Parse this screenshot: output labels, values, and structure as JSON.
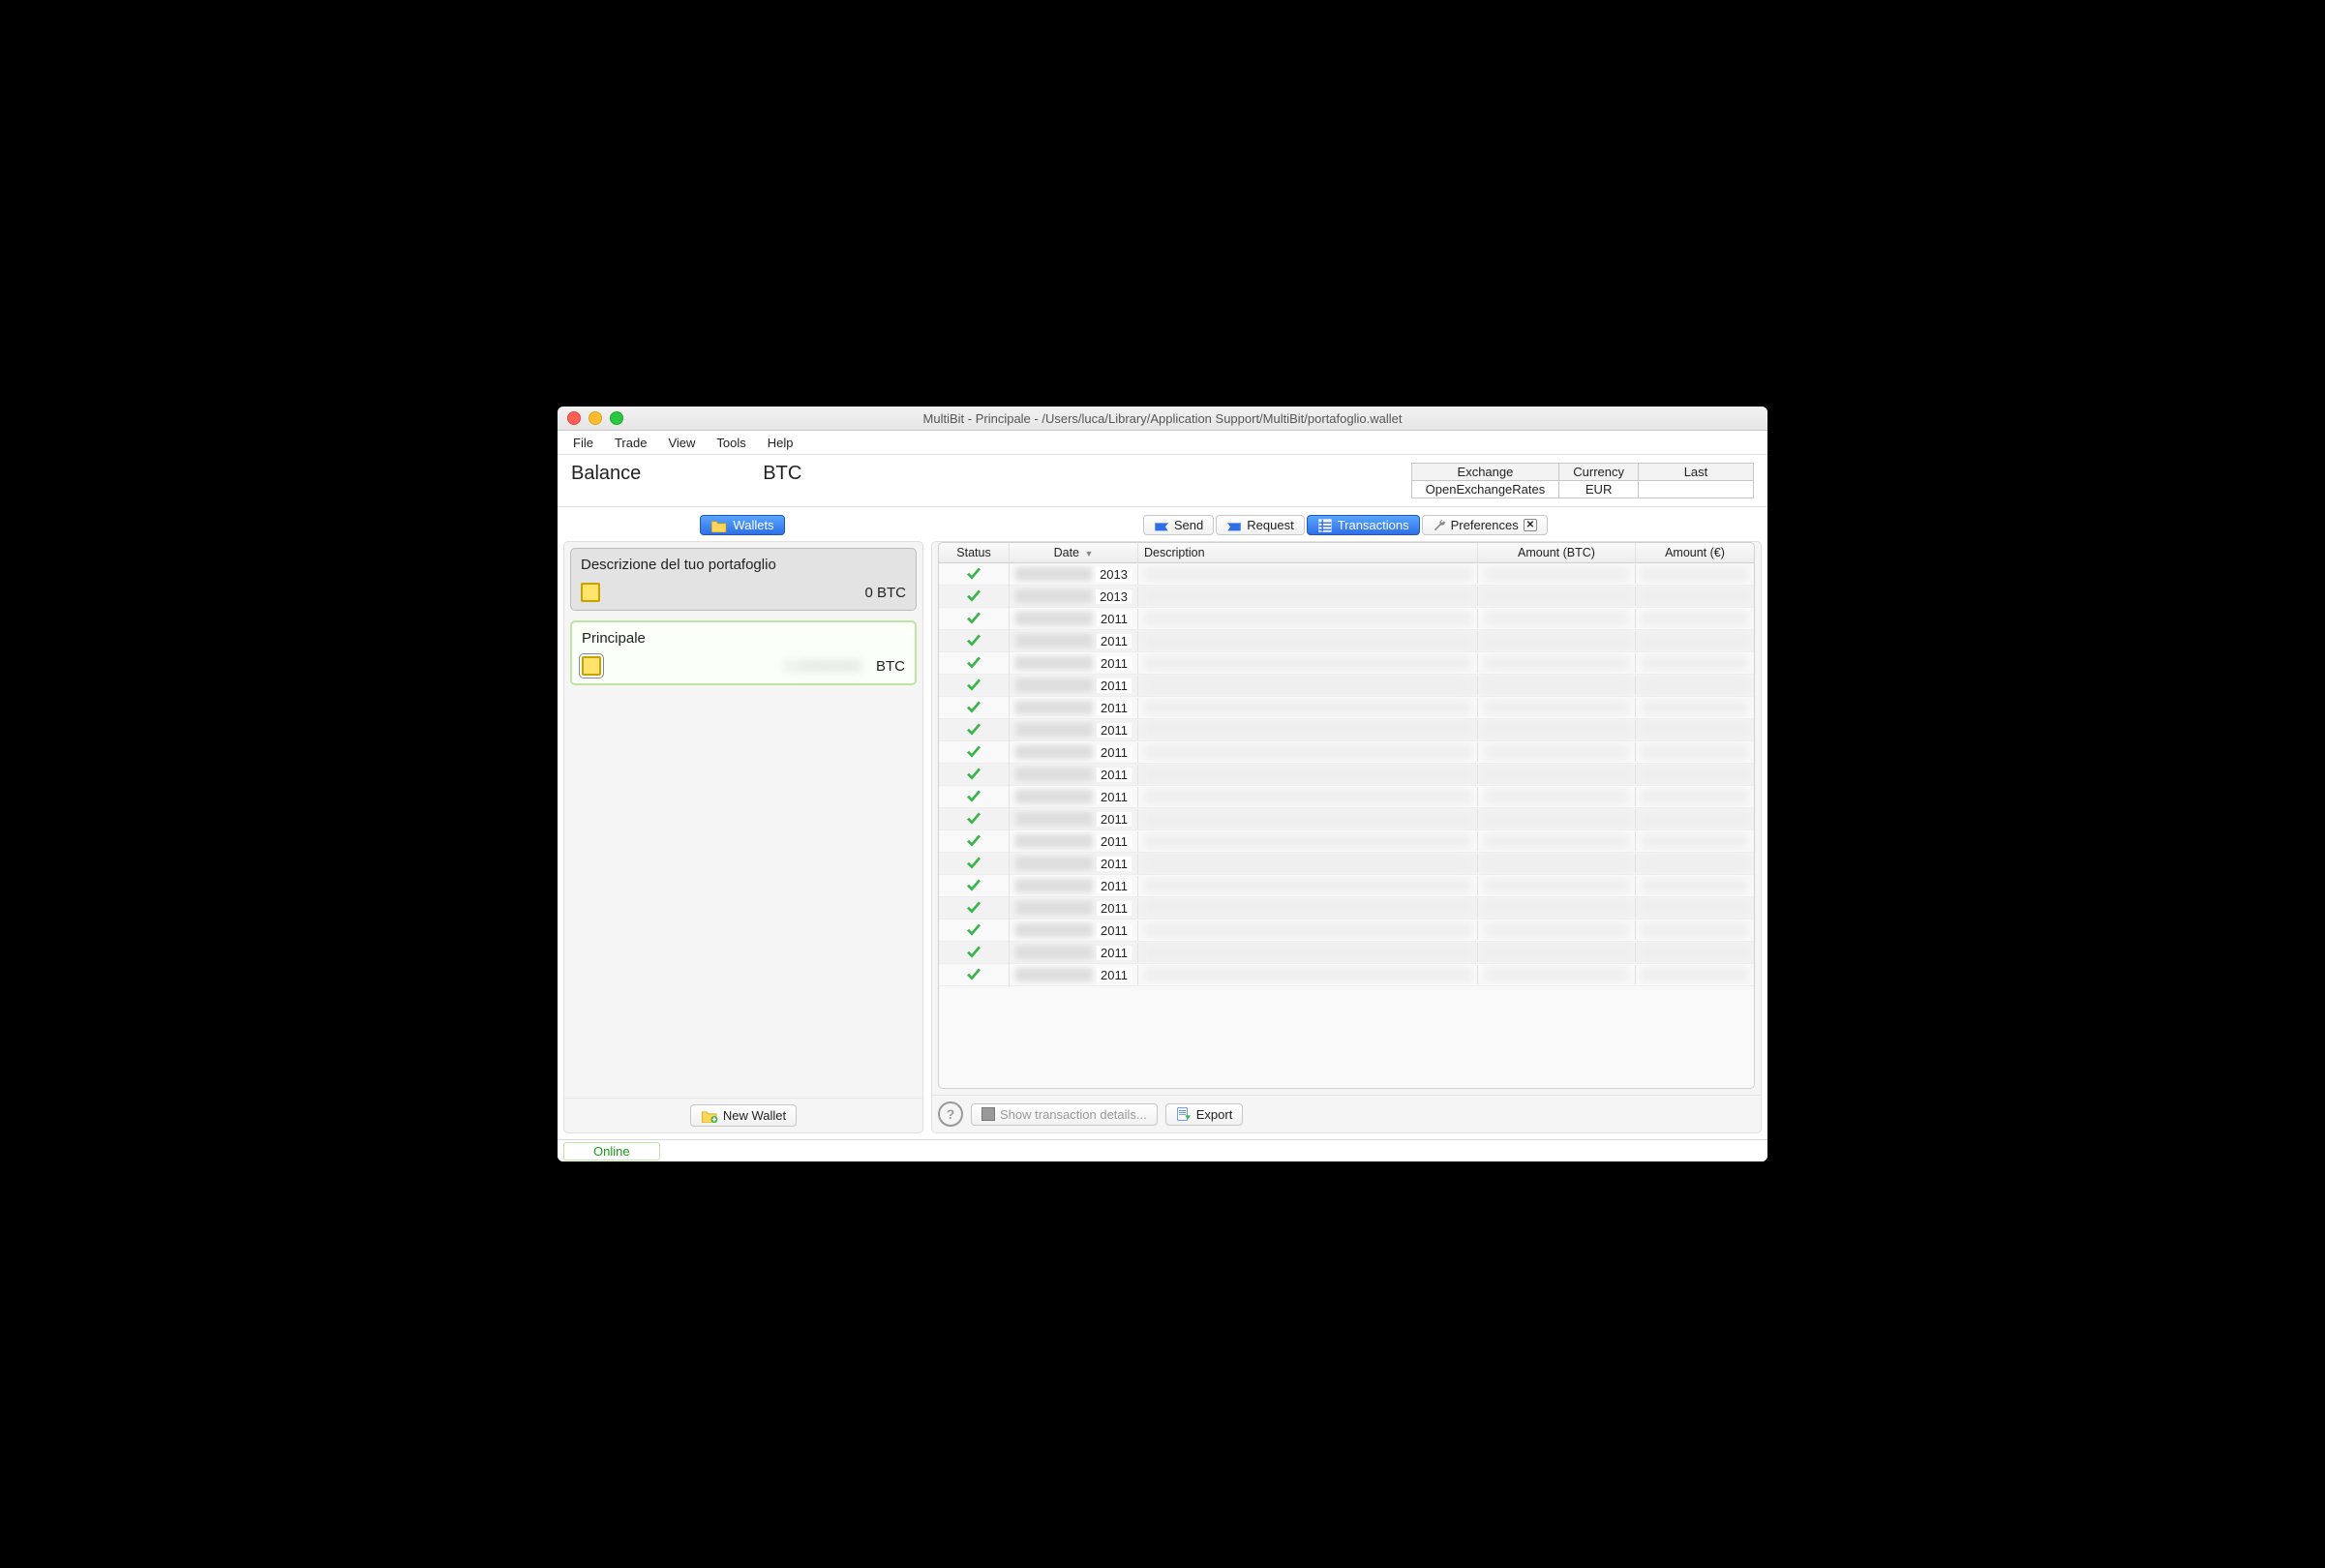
{
  "window": {
    "title": "MultiBit - Principale - /Users/luca/Library/Application Support/MultiBit/portafoglio.wallet"
  },
  "menubar": [
    "File",
    "Trade",
    "View",
    "Tools",
    "Help"
  ],
  "balance": {
    "label": "Balance",
    "value": "",
    "unit": "BTC"
  },
  "rates": {
    "headers": [
      "Exchange",
      "Currency",
      "Last"
    ],
    "row": [
      "OpenExchangeRates",
      "EUR",
      ""
    ]
  },
  "left": {
    "tab": "Wallets",
    "wallets": [
      {
        "name": "Descrizione del tuo portafoglio",
        "balance": "0 BTC",
        "selected": false,
        "obscured": false
      },
      {
        "name": "Principale",
        "balance_unit": "BTC",
        "selected": true,
        "obscured": true
      }
    ],
    "new_wallet": "New Wallet"
  },
  "right": {
    "tabs": {
      "send": "Send",
      "request": "Request",
      "transactions": "Transactions",
      "preferences": "Preferences"
    },
    "columns": {
      "status": "Status",
      "date": "Date",
      "desc": "Description",
      "amount_btc": "Amount (BTC)",
      "amount_eur": "Amount (€)"
    },
    "rows": [
      {
        "status": "ok",
        "year": "2013"
      },
      {
        "status": "ok",
        "year": "2013"
      },
      {
        "status": "ok",
        "year": "2011"
      },
      {
        "status": "ok",
        "year": "2011"
      },
      {
        "status": "ok",
        "year": "2011"
      },
      {
        "status": "ok",
        "year": "2011"
      },
      {
        "status": "ok",
        "year": "2011"
      },
      {
        "status": "ok",
        "year": "2011"
      },
      {
        "status": "ok",
        "year": "2011"
      },
      {
        "status": "ok",
        "year": "2011"
      },
      {
        "status": "ok",
        "year": "2011"
      },
      {
        "status": "ok",
        "year": "2011"
      },
      {
        "status": "ok",
        "year": "2011"
      },
      {
        "status": "ok",
        "year": "2011"
      },
      {
        "status": "ok",
        "year": "2011"
      },
      {
        "status": "ok",
        "year": "2011"
      },
      {
        "status": "ok",
        "year": "2011"
      },
      {
        "status": "ok",
        "year": "2011"
      },
      {
        "status": "ok",
        "year": "2011"
      }
    ],
    "bottom": {
      "show_details": "Show transaction details...",
      "export": "Export"
    }
  },
  "status": {
    "online": "Online"
  }
}
